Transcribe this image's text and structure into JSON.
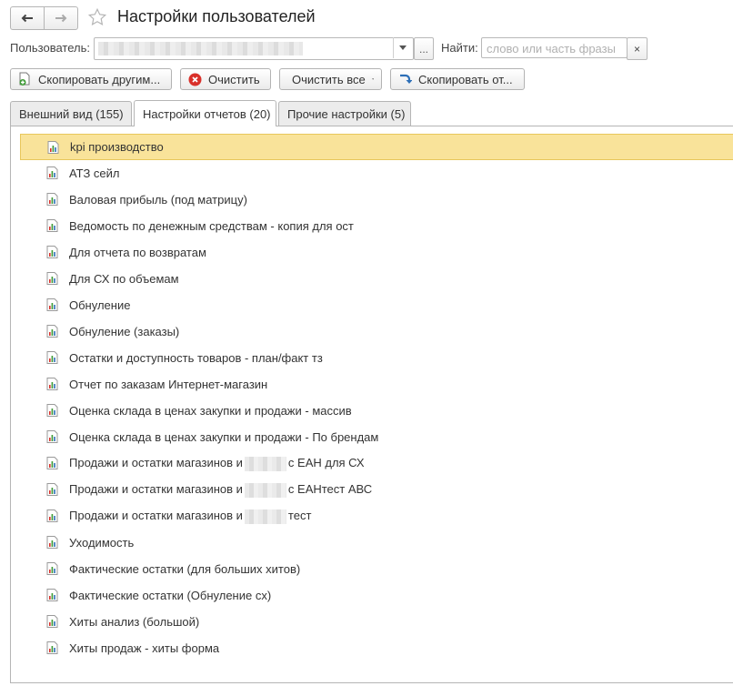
{
  "window": {
    "title": "Настройки пользователей"
  },
  "filter": {
    "user_label": "Пользователь:",
    "user_value": "",
    "user_select_label": "...",
    "find_label": "Найти:",
    "find_placeholder": "слово или часть фразы",
    "clear_label": "×"
  },
  "toolbar": {
    "copy_to_others": "Скопировать другим...",
    "clear": "Очистить",
    "clear_all": "Очистить все",
    "copy_from": "Скопировать от..."
  },
  "tabs": [
    {
      "label": "Внешний вид (155)",
      "active": false
    },
    {
      "label": "Настройки отчетов (20)",
      "active": true
    },
    {
      "label": "Прочие настройки (5)",
      "active": false
    }
  ],
  "reports": [
    {
      "parts": [
        "kpi производство"
      ],
      "selected": true
    },
    {
      "parts": [
        "АТЗ сейл"
      ]
    },
    {
      "parts": [
        "Валовая прибыль (под матрицу)"
      ]
    },
    {
      "parts": [
        "Ведомость по денежным средствам - копия для ост"
      ]
    },
    {
      "parts": [
        "Для отчета по возвратам"
      ]
    },
    {
      "parts": [
        "Для СХ по объемам"
      ]
    },
    {
      "parts": [
        "Обнуление"
      ]
    },
    {
      "parts": [
        "Обнуление (заказы)"
      ]
    },
    {
      "parts": [
        "Остатки и доступность товаров - план/факт тз"
      ]
    },
    {
      "parts": [
        "Отчет по заказам Интернет-магазин"
      ]
    },
    {
      "parts": [
        "Оценка склада в ценах закупки и продажи - массив"
      ]
    },
    {
      "parts": [
        "Оценка склада в ценах закупки и продажи - По брендам"
      ]
    },
    {
      "parts": [
        "Продажи и остатки магазинов и",
        "с ЕАН для СХ"
      ]
    },
    {
      "parts": [
        "Продажи и остатки магазинов и",
        "с ЕАНтест АВС"
      ]
    },
    {
      "parts": [
        "Продажи и остатки магазинов и",
        "тест"
      ]
    },
    {
      "parts": [
        "Уходимость"
      ]
    },
    {
      "parts": [
        "Фактические остатки (для больших хитов)"
      ]
    },
    {
      "parts": [
        "Фактические остатки (Обнуление сх)"
      ]
    },
    {
      "parts": [
        "Хиты анализ (большой)"
      ]
    },
    {
      "parts": [
        "Хиты продаж - хиты форма"
      ]
    }
  ],
  "colors": {
    "selection": "#f9e39a",
    "accent_red": "#d9302a",
    "accent_blue": "#2d6fb7",
    "accent_green": "#3d9b35"
  }
}
